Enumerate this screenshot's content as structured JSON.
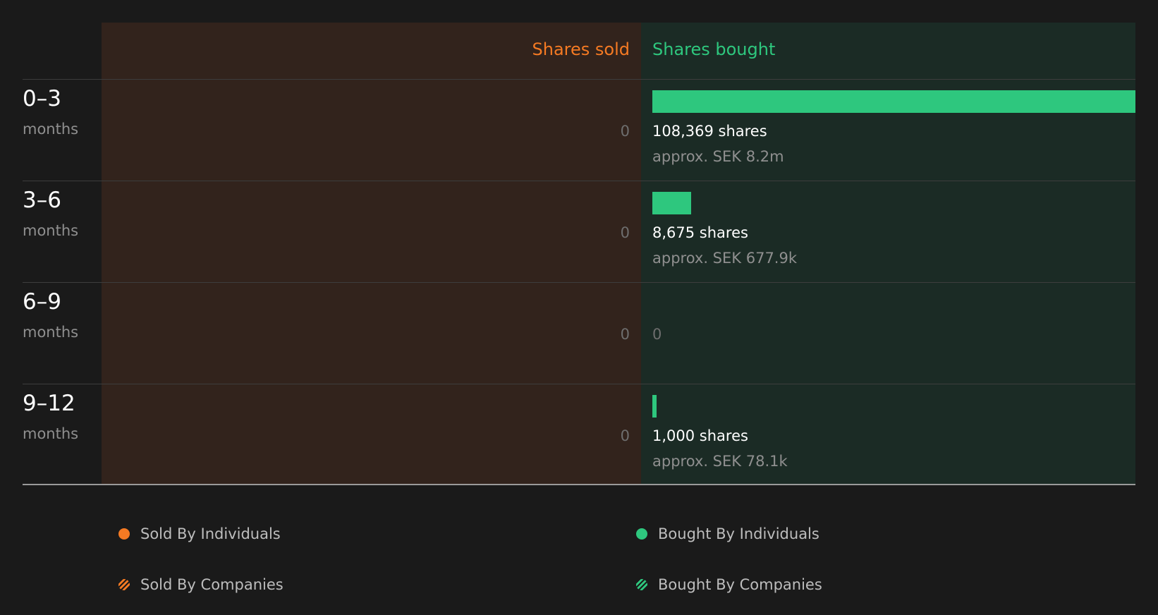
{
  "colors": {
    "sold": "#f57a23",
    "bought": "#2ec77e"
  },
  "headers": {
    "sold": "Shares sold",
    "bought": "Shares bought"
  },
  "legend": [
    {
      "label": "Sold By Individuals",
      "style": "solid",
      "color": "#f57a23"
    },
    {
      "label": "Bought By Individuals",
      "style": "solid",
      "color": "#2ec77e"
    },
    {
      "label": "Sold By Companies",
      "style": "hatched",
      "color": "#f57a23"
    },
    {
      "label": "Bought By Companies",
      "style": "hatched",
      "color": "#2ec77e"
    }
  ],
  "chart_data": {
    "type": "bar",
    "orientation": "horizontal",
    "categories": [
      "0–3",
      "3–6",
      "6–9",
      "9–12"
    ],
    "category_unit": "months",
    "series": [
      {
        "name": "Shares sold",
        "values": [
          0,
          0,
          0,
          0
        ]
      },
      {
        "name": "Shares bought",
        "values": [
          108369,
          8675,
          0,
          1000
        ]
      }
    ],
    "rows": [
      {
        "period": "0–3",
        "unit": "months",
        "sold_label": "0",
        "bought_shares": 108369,
        "bought_label": "108,369 shares",
        "approx": "approx. SEK 8.2m"
      },
      {
        "period": "3–6",
        "unit": "months",
        "sold_label": "0",
        "bought_shares": 8675,
        "bought_label": "8,675 shares",
        "approx": "approx. SEK 677.9k"
      },
      {
        "period": "6–9",
        "unit": "months",
        "sold_label": "0",
        "bought_shares": 0,
        "bought_label": "0",
        "approx": ""
      },
      {
        "period": "9–12",
        "unit": "months",
        "sold_label": "0",
        "bought_shares": 1000,
        "bought_label": "1,000 shares",
        "approx": "approx. SEK 78.1k"
      }
    ]
  }
}
